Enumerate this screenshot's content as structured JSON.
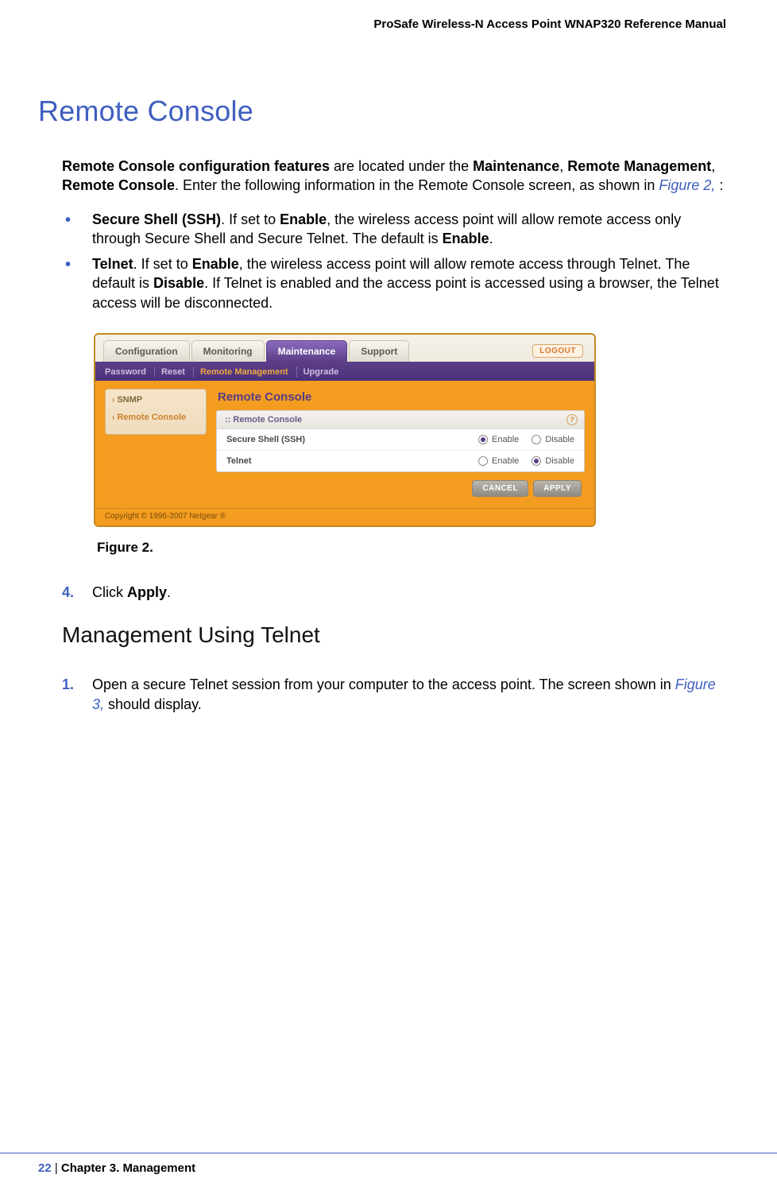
{
  "header": {
    "manual_title": "ProSafe Wireless-N Access Point WNAP320 Reference Manual"
  },
  "section": {
    "title": "Remote Console",
    "intro_pre_bold": "Remote Console configuration features",
    "intro_mid1": " are located under the ",
    "intro_b1": "Maintenance",
    "intro_c1": ", ",
    "intro_b2": "Remote Management",
    "intro_c2": ", ",
    "intro_b3": "Remote Console",
    "intro_mid2": ". Enter the following information in the Remote Console screen, as shown in ",
    "intro_link": "Figure 2,",
    "intro_end": " :"
  },
  "bullets": [
    {
      "b0": "Secure Shell (SSH)",
      "t1": ". If set to ",
      "b1": "Enable",
      "t2": ", the wireless access point will allow remote access only through Secure Shell and Secure Telnet. The default is ",
      "b2": "Enable",
      "t3": "."
    },
    {
      "b0": "Telnet",
      "t1": ". If set to ",
      "b1": "Enable",
      "t2": ", the wireless access point will allow remote access through Telnet. The default is ",
      "b2": "Disable",
      "t3": ". If Telnet is enabled and the access point is accessed using a browser, the Telnet access will be disconnected."
    }
  ],
  "figure": {
    "tabs": [
      "Configuration",
      "Monitoring",
      "Maintenance",
      "Support"
    ],
    "logout": "LOGOUT",
    "subnav": [
      "Password",
      "Reset",
      "Remote Management",
      "Upgrade"
    ],
    "side": [
      "SNMP",
      "Remote Console"
    ],
    "title": "Remote Console",
    "panel_head": ":: Remote Console",
    "rows": [
      {
        "label": "Secure Shell (SSH)",
        "enable": "Enable",
        "disable": "Disable",
        "selected": "enable"
      },
      {
        "label": "Telnet",
        "enable": "Enable",
        "disable": "Disable",
        "selected": "disable"
      }
    ],
    "buttons": {
      "cancel": "CANCEL",
      "apply": "APPLY"
    },
    "copyright": "Copyright © 1996-2007 Netgear ®",
    "caption": "Figure 2."
  },
  "step4": {
    "num": "4.",
    "pre": "Click ",
    "bold": "Apply",
    "post": "."
  },
  "subsection": {
    "title": "Management Using Telnet"
  },
  "step1": {
    "num": "1.",
    "pre": "Open a secure Telnet session from your computer to the access point. The screen shown in ",
    "link": "Figure 3,",
    "post": "  should display."
  },
  "footer": {
    "page": "22",
    "sep": "   |   ",
    "chapter": "Chapter 3.  Management"
  }
}
